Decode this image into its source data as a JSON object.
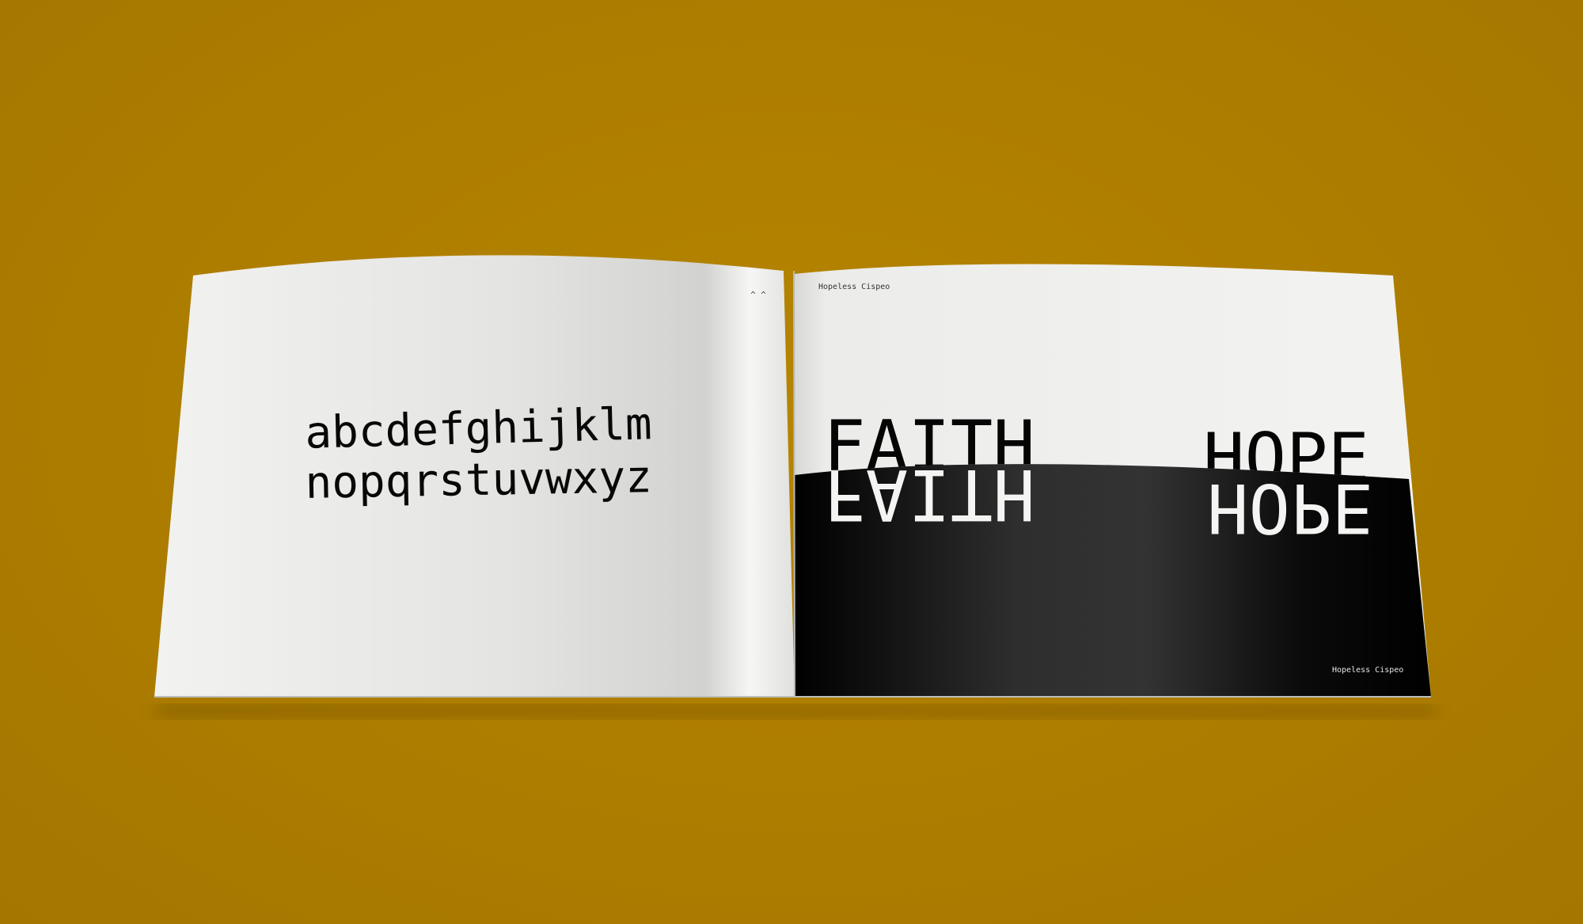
{
  "scene": {
    "background_color": "#ae7e00",
    "paper_color": "#e9e9e7",
    "ink_color": "#050505"
  },
  "left_page": {
    "alphabet_line_1": "abcdefghijklm",
    "alphabet_line_2": "nopqrstuvwxyz",
    "corner_mark": "^ ^"
  },
  "right_page": {
    "header_label": "Hopeless Cispeo",
    "word_1": "FAITH",
    "word_2": "HOPE",
    "footer_label": "Hopeless Cispeo"
  }
}
